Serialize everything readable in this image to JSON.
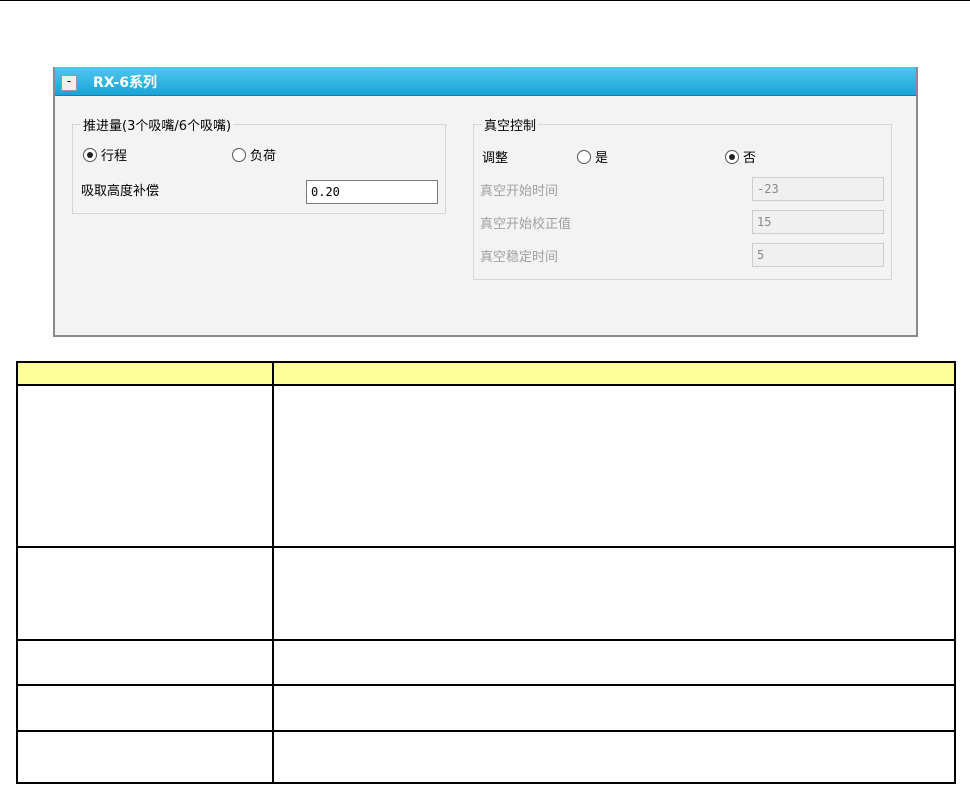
{
  "panel": {
    "title": "RX-6系列",
    "collapse_label": "-",
    "thrust": {
      "legend": "推进量(3个吸嘴/6个吸嘴)",
      "options": [
        {
          "label": "行程",
          "checked": true
        },
        {
          "label": "负荷",
          "checked": false
        }
      ],
      "height_comp_label": "吸取高度补偿",
      "height_comp_value": "0.20"
    },
    "vacuum": {
      "legend": "真空控制",
      "adjust_label": "调整",
      "options": [
        {
          "label": "是",
          "checked": false
        },
        {
          "label": "否",
          "checked": true
        }
      ],
      "fields": [
        {
          "label": "真空开始时间",
          "value": "-23"
        },
        {
          "label": "真空开始校正值",
          "value": "15"
        },
        {
          "label": "真空稳定时间",
          "value": "5"
        }
      ]
    }
  },
  "colors": {
    "titlebar": "#1aa3d8",
    "table_header": "#ffff99"
  }
}
